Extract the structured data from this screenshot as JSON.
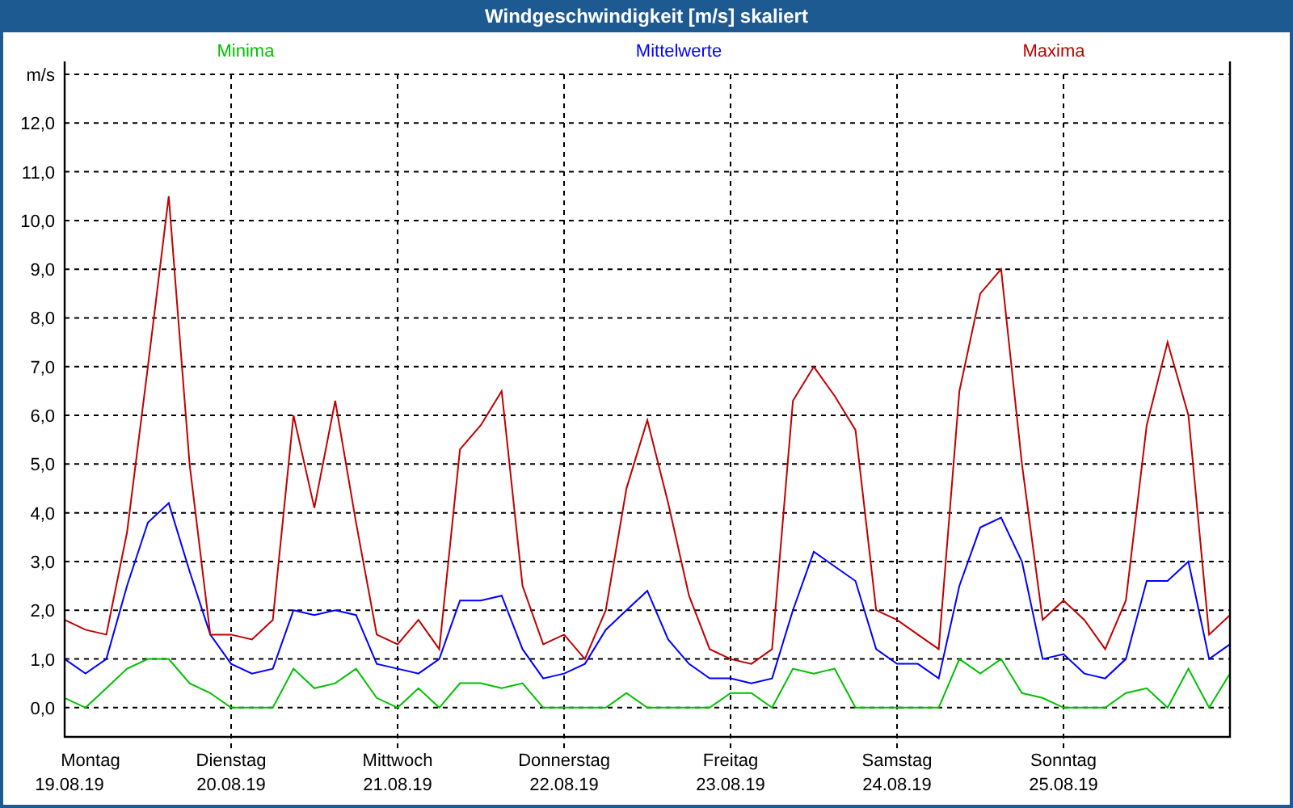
{
  "window": {
    "title": "Windgeschwindigkeit [m/s] skaliert"
  },
  "chart": {
    "weekdays": [
      "Montag",
      "Dienstag",
      "Mittwoch",
      "Donnerstag",
      "Freitag",
      "Samstag",
      "Sonntag"
    ],
    "chart_data": {
      "type": "line",
      "ylabel": "m/s",
      "grid": true,
      "categories": [
        "19.08.19",
        null,
        null,
        null,
        null,
        null,
        null,
        null,
        "20.08.19",
        null,
        null,
        null,
        null,
        null,
        null,
        null,
        "21.08.19",
        null,
        null,
        null,
        null,
        null,
        null,
        null,
        "22.08.19",
        null,
        null,
        null,
        null,
        null,
        null,
        null,
        "23.08.19",
        null,
        null,
        null,
        null,
        null,
        null,
        null,
        "24.08.19",
        null,
        null,
        null,
        null,
        null,
        null,
        null,
        "25.08.19",
        null,
        null,
        null,
        null,
        null,
        null,
        null,
        null
      ],
      "ylim": [
        -0.6,
        13
      ],
      "yticks": [
        {
          "value": 0,
          "label": "0,0"
        },
        {
          "value": 1,
          "label": "1,0"
        },
        {
          "value": 2,
          "label": "2,0"
        },
        {
          "value": 3,
          "label": "3,0"
        },
        {
          "value": 4,
          "label": "4,0"
        },
        {
          "value": 5,
          "label": "5,0"
        },
        {
          "value": 6,
          "label": "6,0"
        },
        {
          "value": 7,
          "label": "7,0"
        },
        {
          "value": 8,
          "label": "8,0"
        },
        {
          "value": 9,
          "label": "9,0"
        },
        {
          "value": 10,
          "label": "10,0"
        },
        {
          "value": 11,
          "label": "11,0"
        },
        {
          "value": 12,
          "label": "12,0"
        }
      ],
      "series": [
        {
          "name": "Minima",
          "color": "#00c000",
          "values": [
            0.2,
            0.0,
            0.4,
            0.8,
            1.0,
            1.0,
            0.5,
            0.3,
            0.0,
            0.0,
            0.0,
            0.8,
            0.4,
            0.5,
            0.8,
            0.2,
            0.0,
            0.4,
            0.0,
            0.5,
            0.5,
            0.4,
            0.5,
            0.0,
            0.0,
            0.0,
            0.0,
            0.3,
            0.0,
            0.0,
            0.0,
            0.0,
            0.3,
            0.3,
            0.0,
            0.8,
            0.7,
            0.8,
            0.0,
            0.0,
            0.0,
            0.0,
            0.0,
            1.0,
            0.7,
            1.0,
            0.3,
            0.2,
            0.0,
            0.0,
            0.0,
            0.3,
            0.4,
            0.0,
            0.8,
            0.0,
            0.7
          ]
        },
        {
          "name": "Mittelwerte",
          "color": "#0000ff",
          "values": [
            1.0,
            0.7,
            1.0,
            2.5,
            3.8,
            4.2,
            2.8,
            1.5,
            0.9,
            0.7,
            0.8,
            2.0,
            1.9,
            2.0,
            1.9,
            0.9,
            0.8,
            0.7,
            1.0,
            2.2,
            2.2,
            2.3,
            1.2,
            0.6,
            0.7,
            0.9,
            1.6,
            2.0,
            2.4,
            1.4,
            0.9,
            0.6,
            0.6,
            0.5,
            0.6,
            2.0,
            3.2,
            2.9,
            2.6,
            1.2,
            0.9,
            0.9,
            0.6,
            2.5,
            3.7,
            3.9,
            3.0,
            1.0,
            1.1,
            0.7,
            0.6,
            1.0,
            2.6,
            2.6,
            3.0,
            1.0,
            1.3
          ]
        },
        {
          "name": "Maxima",
          "color": "#c00000",
          "values": [
            1.8,
            1.6,
            1.5,
            3.6,
            7.0,
            10.5,
            5.0,
            1.5,
            1.5,
            1.4,
            1.8,
            6.0,
            4.1,
            6.3,
            3.8,
            1.5,
            1.3,
            1.8,
            1.2,
            5.3,
            5.8,
            6.5,
            2.5,
            1.3,
            1.5,
            1.0,
            2.0,
            4.5,
            5.9,
            4.2,
            2.3,
            1.2,
            1.0,
            0.9,
            1.2,
            6.3,
            7.0,
            6.4,
            5.7,
            2.0,
            1.8,
            1.5,
            1.2,
            6.5,
            8.5,
            9.0,
            5.0,
            1.8,
            2.2,
            1.8,
            1.2,
            2.2,
            5.8,
            7.5,
            6.0,
            1.5,
            1.9
          ]
        }
      ]
    }
  }
}
